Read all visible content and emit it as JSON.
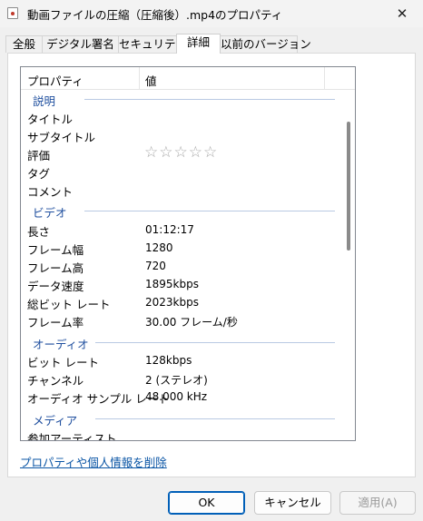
{
  "window": {
    "title": "動画ファイルの圧縮（圧縮後）.mp4のプロパティ",
    "close": "✕"
  },
  "tabs": [
    {
      "label": "全般"
    },
    {
      "label": "デジタル署名"
    },
    {
      "label": "セキュリティ"
    },
    {
      "label": "詳細",
      "active": true
    },
    {
      "label": "以前のバージョン"
    }
  ],
  "list": {
    "col_property": "プロパティ",
    "col_value": "値",
    "groups": {
      "description": "説明",
      "video": "ビデオ",
      "audio": "オーディオ",
      "media": "メディア"
    },
    "rows": [
      {
        "prop": "タイトル",
        "value": ""
      },
      {
        "prop": "サブタイトル",
        "value": ""
      },
      {
        "prop": "評価",
        "value": ""
      },
      {
        "prop": "タグ",
        "value": ""
      },
      {
        "prop": "コメント",
        "value": ""
      },
      {
        "prop": "長さ",
        "value": "01:12:17"
      },
      {
        "prop": "フレーム幅",
        "value": "1280"
      },
      {
        "prop": "フレーム高",
        "value": "720"
      },
      {
        "prop": "データ速度",
        "value": "1895kbps"
      },
      {
        "prop": "総ビット レート",
        "value": "2023kbps"
      },
      {
        "prop": "フレーム率",
        "value": "30.00 フレーム/秒"
      },
      {
        "prop": "ビット レート",
        "value": "128kbps"
      },
      {
        "prop": "チャンネル",
        "value": "2 (ステレオ)"
      },
      {
        "prop": "オーディオ サンプル レート",
        "value": "48.000 kHz"
      },
      {
        "prop": "参加アーティスト",
        "value": ""
      }
    ],
    "rating": {
      "stars": "☆☆☆☆☆",
      "value": 0,
      "max": 5
    }
  },
  "remove_link": "プロパティや個人情報を削除",
  "buttons": {
    "ok": "OK",
    "cancel": "キャンセル",
    "apply": "適用(A)"
  },
  "colors": {
    "group_label": "#1e4e9e",
    "link": "#0a55a5",
    "ok_border": "#005fb8"
  }
}
